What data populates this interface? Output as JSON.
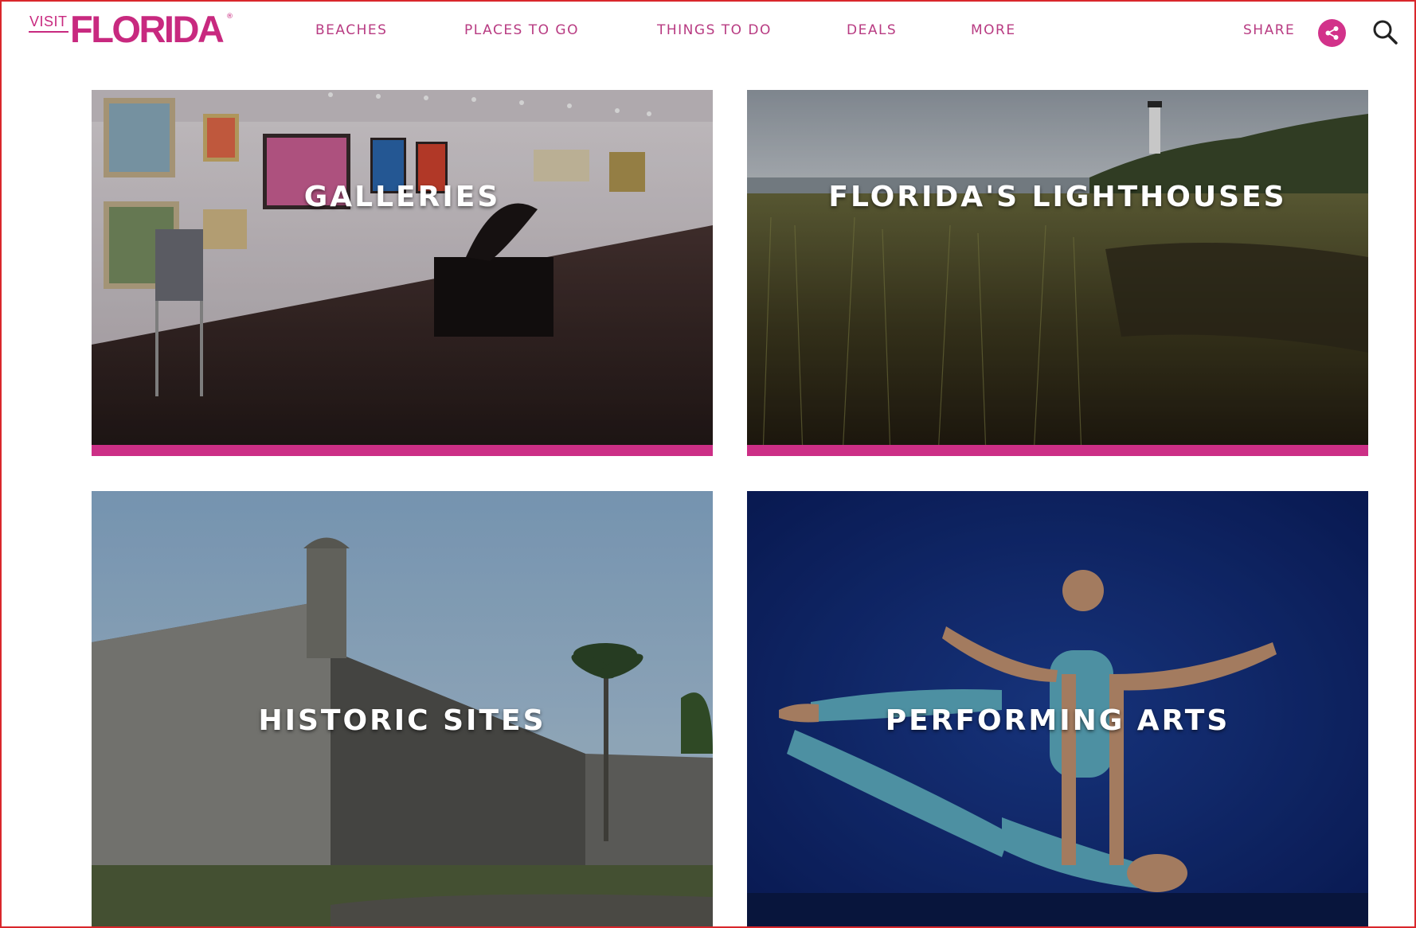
{
  "header": {
    "logo": {
      "visit": "VISIT",
      "brand": "FLORIDA",
      "reg": "®"
    },
    "nav": [
      {
        "label": "BEACHES"
      },
      {
        "label": "PLACES TO GO"
      },
      {
        "label": "THINGS TO DO"
      },
      {
        "label": "DEALS"
      },
      {
        "label": "MORE"
      }
    ],
    "share_label": "SHARE",
    "icons": {
      "share": "share-icon",
      "search": "search-icon"
    }
  },
  "tiles": [
    {
      "label": "GALLERIES",
      "scene": "art gallery interior",
      "accent_bar": true
    },
    {
      "label": "FLORIDA'S LIGHTHOUSES",
      "scene": "marsh with lighthouse",
      "accent_bar": true
    },
    {
      "label": "HISTORIC SITES",
      "scene": "stone fort with palm tree",
      "accent_bar": false
    },
    {
      "label": "PERFORMING ARTS",
      "scene": "dancers on blue stage",
      "accent_bar": false
    }
  ],
  "colors": {
    "brand": "#c8297f",
    "nav_text": "#b83b82",
    "accent_bar": "#cc2f86",
    "frame": "#d9262b"
  }
}
